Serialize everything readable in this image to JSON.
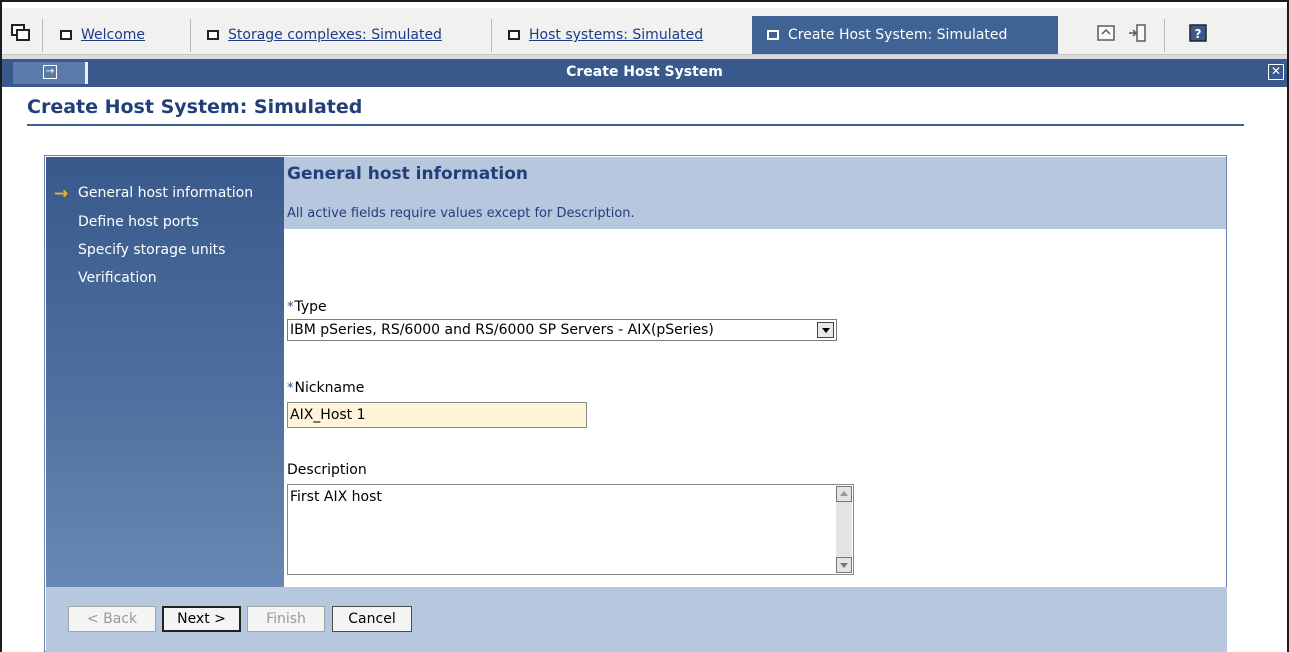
{
  "tabs": [
    {
      "label": "Welcome",
      "active": false
    },
    {
      "label": "Storage complexes: Simulated",
      "active": false
    },
    {
      "label": "Host systems: Simulated",
      "active": false
    },
    {
      "label": "Create Host System: Simulated",
      "active": true
    }
  ],
  "toolbar_icons": [
    "window-icon",
    "home-icon",
    "logout-icon",
    "help-icon"
  ],
  "portlet": {
    "title": "Create Host System"
  },
  "page": {
    "title": "Create Host System: Simulated"
  },
  "wizard": {
    "steps": [
      {
        "label": "General host information",
        "current": true
      },
      {
        "label": "Define host ports",
        "current": false
      },
      {
        "label": "Specify storage units",
        "current": false
      },
      {
        "label": "Verification",
        "current": false
      }
    ],
    "section_title": "General host information",
    "instructions": "All active fields require values except for Description.",
    "fields": {
      "type": {
        "label": "Type",
        "required_mark": "*",
        "value": "IBM pSeries, RS/6000 and RS/6000 SP Servers - AIX(pSeries)"
      },
      "nickname": {
        "label": "Nickname",
        "required_mark": "*",
        "value": "AIX_Host 1"
      },
      "description": {
        "label": "Description",
        "value": "First AIX host"
      }
    },
    "buttons": {
      "back": "< Back",
      "next": "Next >",
      "finish": "Finish",
      "cancel": "Cancel"
    }
  },
  "colors": {
    "titlebar": "#39598c",
    "active_tab": "#3f6394",
    "panel": "#b7c7de",
    "nickname_bg": "#fef4d9",
    "accent_arrow": "#f3b321"
  }
}
